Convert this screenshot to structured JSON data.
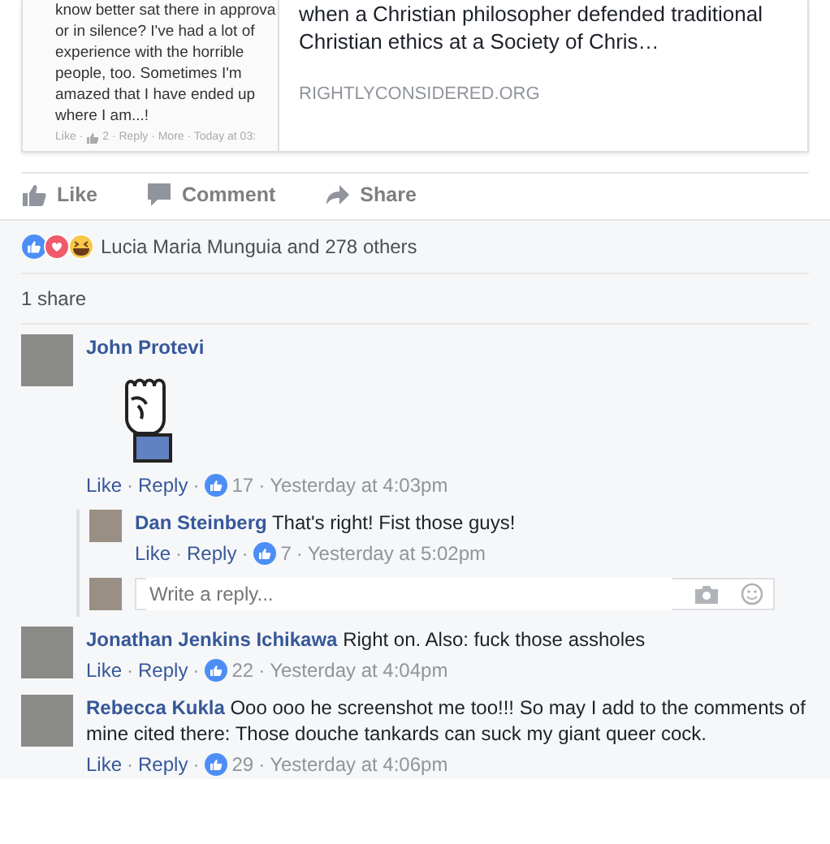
{
  "link_preview": {
    "screenshot_lines": [
      "know better sat there in approva",
      "or in silence? I've had a lot of",
      "experience with the horrible",
      "people, too. Sometimes I'm",
      "amazed that I have ended up",
      "where I am...!"
    ],
    "screenshot_meta": [
      "Like ·",
      "2 · Reply · More · Today at 03:"
    ],
    "description": "when a Christian philosopher defended traditional Christian ethics at a Society of Chris…",
    "domain": "RIGHTLYCONSIDERED.ORG"
  },
  "actions": [
    {
      "kind": "like",
      "label": "Like"
    },
    {
      "kind": "comment",
      "label": "Comment"
    },
    {
      "kind": "share",
      "label": "Share"
    }
  ],
  "reactions": {
    "summary": "Lucia Maria Munguia and 278 others"
  },
  "shares": "1 share",
  "comments": [
    {
      "author": "John Protevi",
      "kind": "sticker",
      "like": "Like",
      "sep": "·",
      "reply": "Reply",
      "likes": "17",
      "time": "Yesterday at 4:03pm",
      "replies": [
        {
          "author": "Dan Steinberg",
          "kind": "text",
          "text": "That's right! Fist those guys!",
          "like": "Like",
          "sep": "·",
          "reply": "Reply",
          "likes": "7",
          "time": "Yesterday at 5:02pm"
        }
      ],
      "reply_box": {
        "placeholder": "Write a reply..."
      }
    },
    {
      "author": "Jonathan Jenkins Ichikawa",
      "kind": "text",
      "text": "Right on. Also: fuck those assholes",
      "like": "Like",
      "sep": "·",
      "reply": "Reply",
      "likes": "22",
      "time": "Yesterday at 4:04pm"
    },
    {
      "author": "Rebecca Kukla",
      "kind": "text",
      "text": "Ooo ooo he screenshot me too!!! So may I add to the comments of mine cited there: Those douche tankards can suck my giant queer cock.",
      "like": "Like",
      "sep": "·",
      "reply": "Reply",
      "likes": "29",
      "time": "Yesterday at 4:06pm"
    }
  ]
}
